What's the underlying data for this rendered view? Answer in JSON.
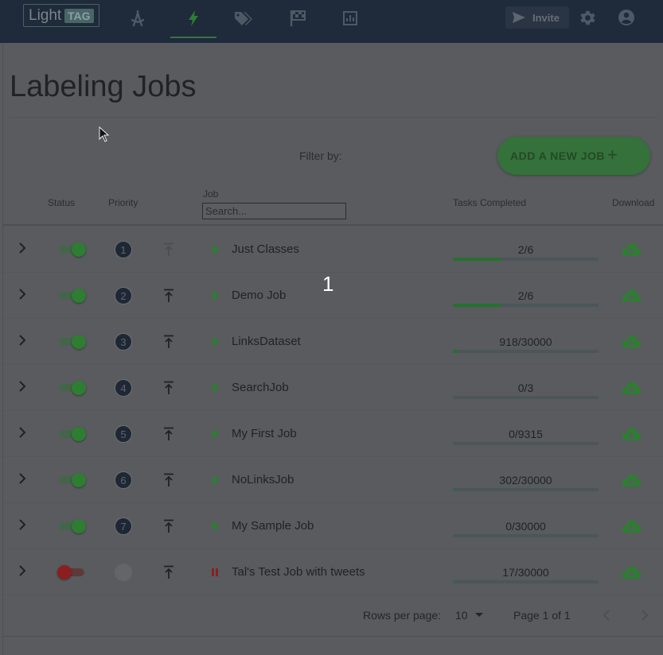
{
  "app": {
    "logo_light": "Light",
    "logo_tag": "TAG",
    "invite_label": "Invite"
  },
  "colors": {
    "accent_green": "#2e7d32",
    "topbar": "#1f2a3b",
    "paused_red": "#8b1f1f"
  },
  "nav_icons": [
    "compass-icon",
    "bolt-icon",
    "tags-icon",
    "flag-checkered-icon",
    "chart-icon"
  ],
  "page": {
    "title": "Labeling Jobs",
    "filter_label": "Filter by:",
    "add_job_label": "ADD A NEW JOB",
    "add_job_icon": "+"
  },
  "table": {
    "headers": {
      "status": "Status",
      "priority": "Priority",
      "job": "Job",
      "tasks": "Tasks Completed",
      "download": "Download"
    },
    "search_placeholder": "Search...",
    "rows": [
      {
        "priority": "1",
        "name": "Just Classes",
        "tasks": "2/6",
        "progress": 0.333,
        "active": true,
        "top": true
      },
      {
        "priority": "2",
        "name": "Demo Job",
        "tasks": "2/6",
        "progress": 0.333,
        "active": true,
        "top": false
      },
      {
        "priority": "3",
        "name": "LinksDataset",
        "tasks": "918/30000",
        "progress": 0.0306,
        "active": true,
        "top": false
      },
      {
        "priority": "4",
        "name": "SearchJob",
        "tasks": "0/3",
        "progress": 0,
        "active": true,
        "top": false
      },
      {
        "priority": "5",
        "name": "My First Job",
        "tasks": "0/9315",
        "progress": 0,
        "active": true,
        "top": false
      },
      {
        "priority": "6",
        "name": "NoLinksJob",
        "tasks": "302/30000",
        "progress": 0.0101,
        "active": true,
        "top": false
      },
      {
        "priority": "7",
        "name": "My Sample Job",
        "tasks": "0/30000",
        "progress": 0,
        "active": true,
        "top": false
      },
      {
        "priority": "",
        "name": "Tal's Test Job with tweets",
        "tasks": "17/30000",
        "progress": 0.0006,
        "active": false,
        "top": false
      }
    ]
  },
  "footer": {
    "rows_per_page_label": "Rows per page:",
    "rows_per_page_value": "10",
    "page_info": "Page 1 of 1"
  },
  "overlay_number": "1"
}
